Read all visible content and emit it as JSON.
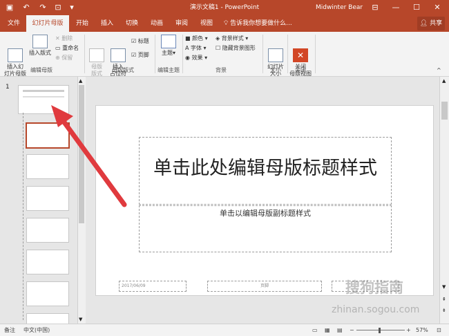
{
  "window": {
    "title": "演示文稿1  -  PowerPoint",
    "user": "Midwinter Bear"
  },
  "tabs": [
    "文件",
    "幻灯片母版",
    "开始",
    "插入",
    "切换",
    "动画",
    "审阅",
    "视图"
  ],
  "tell_me": "告诉我你想要做什么...",
  "share": "共享",
  "ribbon": {
    "insert_master": "插入幻\n灯片母版",
    "insert_layout": "插入版式",
    "delete": "删除",
    "rename": "重命名",
    "preserve": "保留",
    "group_edit_master": "编辑母版",
    "master_layout": "母版\n版式",
    "insert_placeholder": "插入\n占位符",
    "title_cb": "标题",
    "footer_cb": "页脚",
    "group_master_layout": "母版版式",
    "themes": "主题",
    "group_edit_theme": "编辑主题",
    "colors": "颜色",
    "fonts": "字体",
    "effects": "效果",
    "bg_styles": "背景样式",
    "hide_bg": "隐藏背景图形",
    "group_background": "背景",
    "slide_size": "幻灯片\n大小",
    "group_size": "大小",
    "close_master": "关闭\n母版视图",
    "group_close": "关闭"
  },
  "thumb_number": "1",
  "slide": {
    "title": "单击此处编辑母版标题样式",
    "subtitle": "单击以编辑母版副标题样式",
    "date": "2017/06/09",
    "footer": "页脚"
  },
  "status": {
    "left": "备注",
    "language": "中文(中国)",
    "zoom": "57%"
  },
  "watermark": "搜狗指南",
  "watermark_url": "zhinan.sogou.com",
  "colors": {
    "accent": "#b7472a",
    "arrow": "#e03a3e"
  }
}
